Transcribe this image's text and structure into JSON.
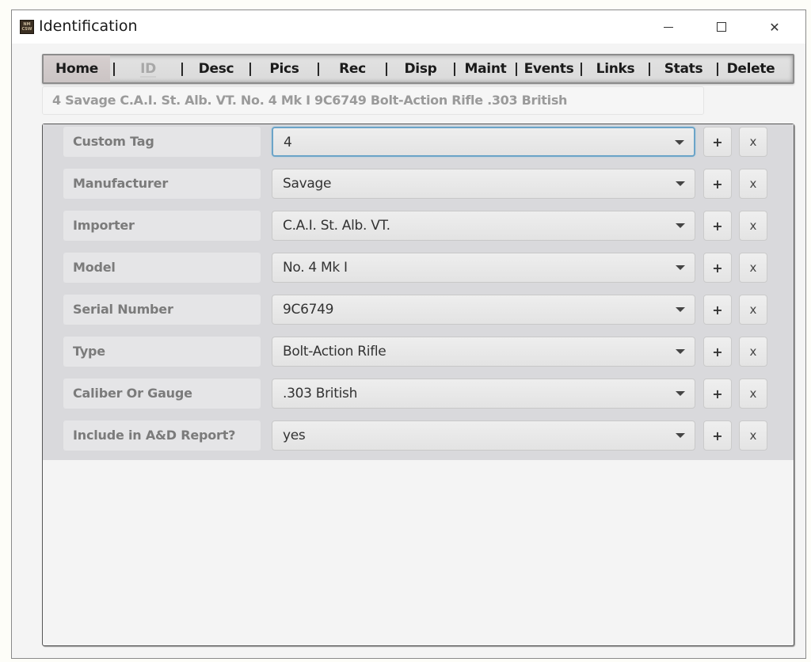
{
  "window": {
    "title": "Identification",
    "app_icon_text": [
      "NM",
      "CSW"
    ],
    "controls": {
      "minimize": "minimize",
      "maximize": "maximize",
      "close": "close"
    }
  },
  "nav": {
    "items": [
      {
        "label": "Home",
        "state": "hover"
      },
      {
        "label": "ID",
        "state": "active"
      },
      {
        "label": "Desc",
        "state": "normal"
      },
      {
        "label": "Pics",
        "state": "normal"
      },
      {
        "label": "Rec",
        "state": "normal"
      },
      {
        "label": "Disp",
        "state": "normal"
      },
      {
        "label": "Maint",
        "state": "normal"
      },
      {
        "label": "Events",
        "state": "normal"
      },
      {
        "label": "Links",
        "state": "normal"
      },
      {
        "label": "Stats",
        "state": "normal"
      },
      {
        "label": "Delete",
        "state": "normal"
      }
    ],
    "separator": "|"
  },
  "summary": "4 Savage C.A.I. St. Alb. VT. No. 4 Mk I 9C6749 Bolt-Action Rifle  .303 British",
  "fields": [
    {
      "label": "Custom Tag",
      "value": "4",
      "focused": true
    },
    {
      "label": "Manufacturer",
      "value": "Savage"
    },
    {
      "label": "Importer",
      "value": "C.A.I. St. Alb. VT."
    },
    {
      "label": "Model",
      "value": "No. 4 Mk I"
    },
    {
      "label": "Serial Number",
      "value": "9C6749"
    },
    {
      "label": "Type",
      "value": "Bolt-Action Rifle"
    },
    {
      "label": "Caliber Or Gauge",
      "value": ".303 British"
    },
    {
      "label": "Include in A&D Report?",
      "value": "yes"
    }
  ],
  "row_buttons": {
    "add": "+",
    "remove": "x"
  },
  "colors": {
    "focus_border": "#6ba4c8",
    "form_background": "#d9d9dc",
    "label_text": "#7b7b7b",
    "active_tab_text": "#a8a8a8"
  }
}
